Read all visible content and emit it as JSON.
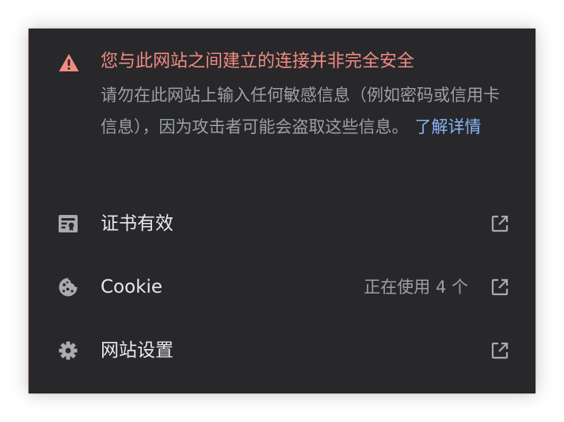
{
  "warning": {
    "icon": "warning-triangle-icon",
    "title": "您与此网站之间建立的连接并非完全安全",
    "body": "请勿在此网站上输入任何敏感信息（例如密码或信用卡信息），因为攻击者可能会盗取这些信息。",
    "learn_more": "了解详情"
  },
  "rows": {
    "certificate": {
      "icon": "certificate-icon",
      "label": "证书有效",
      "action_icon": "open-external-icon"
    },
    "cookie": {
      "icon": "cookie-icon",
      "label": "Cookie",
      "status": "正在使用 4 个",
      "action_icon": "open-external-icon"
    },
    "site_settings": {
      "icon": "gear-icon",
      "label": "网站设置",
      "action_icon": "open-external-icon"
    }
  },
  "colors": {
    "panel_background": "#28282b",
    "warning_red": "#f28b82",
    "link_blue": "#8ab4f8",
    "primary_text": "#e8eaed",
    "secondary_text": "#9aa0a6",
    "icon_gray": "#a8abb0"
  }
}
